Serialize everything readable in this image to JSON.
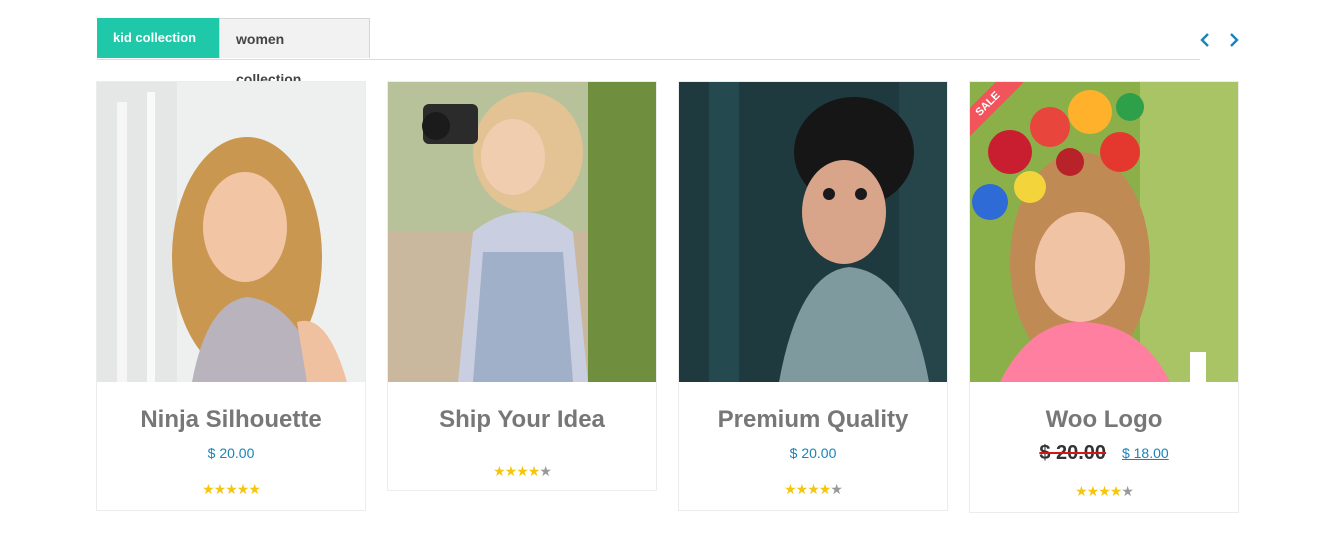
{
  "tabs": [
    {
      "label": "kid collection",
      "active": true
    },
    {
      "label": "women collection",
      "active": false
    }
  ],
  "nav": {
    "prev_icon": "chevron-left-icon",
    "next_icon": "chevron-right-icon",
    "color": "#1a83b8"
  },
  "colors": {
    "accent": "#1fc8a8",
    "price": "#1a83b8",
    "star": "#f5c60c",
    "sale": "#f2545b"
  },
  "products": [
    {
      "title": "Ninja Silhouette",
      "price": "$ 20.00",
      "rating_stars": 5,
      "rating_of": 5
    },
    {
      "title": "Ship Your Idea",
      "price": "",
      "rating_stars": 4,
      "rating_of": 5
    },
    {
      "title": "Premium Quality",
      "price": "$ 20.00",
      "rating_stars": 4,
      "rating_of": 5
    },
    {
      "title": "Woo Logo",
      "old_price": "$ 20.00",
      "price": "$ 18.00",
      "badge": "SALE",
      "rating_stars": 4,
      "rating_of": 5
    }
  ]
}
